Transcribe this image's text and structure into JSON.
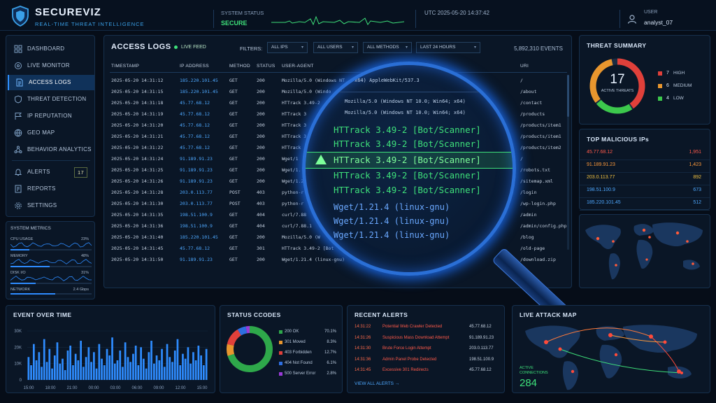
{
  "header": {
    "brand": "SECUREVIZ",
    "tagline": "REAL-TIME THREAT INTELLIGENCE",
    "system_status_label": "SYSTEM STATUS",
    "system_status_value": "SECURE",
    "utc": "UTC  2025-05-20 14:37:42",
    "user_label": "USER",
    "user_name": "analyst_07"
  },
  "sidebar": {
    "items": [
      {
        "label": "DASHBOARD",
        "icon": "dashboard-icon"
      },
      {
        "label": "LIVE MONITOR",
        "icon": "monitor-icon"
      },
      {
        "label": "ACCESS LOGS",
        "icon": "document-icon",
        "active": true
      },
      {
        "label": "THREAT DETECTION",
        "icon": "shield-icon"
      },
      {
        "label": "IP REPUTATION",
        "icon": "flag-icon"
      },
      {
        "label": "GEO MAP",
        "icon": "globe-icon"
      },
      {
        "label": "BEHAVIOR ANALYTICS",
        "icon": "network-icon"
      },
      {
        "label": "ALERTS",
        "icon": "bell-icon",
        "badge": "17"
      },
      {
        "label": "REPORTS",
        "icon": "report-icon"
      },
      {
        "label": "SETTINGS",
        "icon": "gear-icon"
      }
    ]
  },
  "metrics": {
    "title": "SYSTEM METRICS",
    "items": [
      {
        "label": "CPU USAGE",
        "value": "23%",
        "level": 0.23
      },
      {
        "label": "MEMORY",
        "value": "48%",
        "level": 0.48
      },
      {
        "label": "DISK I/O",
        "value": "31%",
        "level": 0.31
      },
      {
        "label": "NETWORK",
        "value": "2.4 Gbps",
        "level": 0.55
      }
    ]
  },
  "logs": {
    "title": "ACCESS LOGS",
    "live": "LIVE FEED",
    "filters_label": "FILTERS:",
    "filters": [
      "ALL IPS",
      "ALL USERS",
      "ALL METHODS",
      "LAST 24 HOURS"
    ],
    "events": "5,892,310 EVENTS",
    "columns": [
      "TIMESTAMP",
      "IP ADDRESS",
      "METHOD",
      "STATUS",
      "USER-AGENT",
      "URI"
    ],
    "rows": [
      [
        "2025-05-20  14:31:12",
        "185.220.101.45",
        "GET",
        "200",
        "Mozilla/5.0 (Windows NT",
        "/"
      ],
      [
        "2025-05-20  14:31:15",
        "185.220.101.45",
        "GET",
        "200",
        "Mozilla/5.0 (Windo",
        "/about"
      ],
      [
        "2025-05-20  14:31:18",
        "45.77.68.12",
        "GET",
        "200",
        "HTTrack 3.49-2",
        "/contact"
      ],
      [
        "2025-05-20  14:31:19",
        "45.77.68.12",
        "GET",
        "200",
        "HTTrack 3",
        "/products"
      ],
      [
        "2025-05-20  14:31:20",
        "45.77.68.12",
        "GET",
        "200",
        "HTTrack 3",
        "/products/item1"
      ],
      [
        "2025-05-20  14:31:21",
        "45.77.68.12",
        "GET",
        "200",
        "HTTrack 3",
        "/products/item1"
      ],
      [
        "2025-05-20  14:31:22",
        "45.77.68.12",
        "GET",
        "200",
        "HTTrack",
        "/products/item2"
      ],
      [
        "2025-05-20  14:31:24",
        "91.189.91.23",
        "GET",
        "200",
        "Wget/1",
        "/"
      ],
      [
        "2025-05-20  14:31:25",
        "91.189.91.23",
        "GET",
        "200",
        "Wget/1.",
        "/robots.txt"
      ],
      [
        "2025-05-20  14:31:26",
        "91.189.91.23",
        "GET",
        "200",
        "Wget/1.2",
        "/sitemap.xml"
      ],
      [
        "2025-05-20  14:31:28",
        "203.0.113.77",
        "POST",
        "403",
        "python-r",
        "/login"
      ],
      [
        "2025-05-20  14:31:30",
        "203.0.113.77",
        "POST",
        "403",
        "python-r",
        "/wp-login.php"
      ],
      [
        "2025-05-20  14:31:35",
        "198.51.100.9",
        "GET",
        "404",
        "curl/7.88",
        "/admin"
      ],
      [
        "2025-05-20  14:31:36",
        "198.51.100.9",
        "GET",
        "404",
        "curl/7.88.1",
        "/admin/config.php"
      ],
      [
        "2025-05-20  14:31:40",
        "185.220.101.45",
        "GET",
        "200",
        "Mozilla/5.0 (W",
        "/blog"
      ],
      [
        "2025-05-20  14:31:45",
        "45.77.68.12",
        "GET",
        "301",
        "HTTrack 3.49-2 [Bot",
        "/old-page"
      ],
      [
        "2025-05-20  14:31:50",
        "91.189.91.23",
        "GET",
        "200",
        "Wget/1.21.4 (linux-gnu)",
        "/download.zip"
      ]
    ]
  },
  "lens": {
    "lines": [
      "x64) AppleWebKit/537.3",
      "Mozilla/5.0 (Windows NT 10.0; Win64; x64)",
      "Mozilla/5.0 (Windows NT 10.0; Win64; x64)",
      "HTTrack 3.49-2 [Bot/Scanner]",
      "HTTrack 3.49-2 [Bot/Scanner]",
      "HTTrack 3.49-2 [Bot/Scanner]",
      "HTTrack 3.49-2 [Bot/Scanner]",
      "HTTrack 3.49-2 [Bot/Scanner]",
      "Wget/1.21.4 (linux-gnu)",
      "Wget/1.21.4 (linux-gnu)",
      "Wget/1.21.4 (linux-gnu)"
    ]
  },
  "threat": {
    "title": "THREAT SUMMARY",
    "count": "17",
    "count_label": "ACTIVE THREATS",
    "items": [
      {
        "n": "7",
        "label": "HIGH",
        "color": "#e0403a"
      },
      {
        "n": "6",
        "label": "MEDIUM",
        "color": "#e8962e"
      },
      {
        "n": "4",
        "label": "LOW",
        "color": "#3cc84c"
      }
    ]
  },
  "topips": {
    "title": "TOP MALICIOUS IPs",
    "items": [
      {
        "ip": "45.77.68.12",
        "n": "1,951",
        "color": "#ff5a4a"
      },
      {
        "ip": "91.189.91.23",
        "n": "1,423",
        "color": "#ff9a3a"
      },
      {
        "ip": "203.0.113.77",
        "n": "892",
        "color": "#f0c040"
      },
      {
        "ip": "198.51.100.9",
        "n": "673",
        "color": "#4ea8ff"
      },
      {
        "ip": "185.220.101.45",
        "n": "512",
        "color": "#4ea8ff"
      }
    ]
  },
  "eot": {
    "title": "EVENT OVER TIME",
    "yticks": [
      "30K",
      "20K",
      "10K",
      "0"
    ],
    "xticks": [
      "15:00",
      "18:00",
      "21:00",
      "00:00",
      "03:00",
      "06:00",
      "09:00",
      "12:00",
      "15:00"
    ]
  },
  "chart_data": {
    "type": "bar",
    "title": "EVENT OVER TIME",
    "ylim": [
      0,
      30000
    ],
    "values": [
      14000,
      9000,
      22000,
      12000,
      17000,
      8000,
      25000,
      11000,
      19000,
      7000,
      15000,
      23000,
      10000,
      13000,
      6000,
      18000,
      21000,
      9000,
      16000,
      12000,
      24000,
      8000,
      14000,
      20000,
      11000,
      17000,
      7000,
      22000,
      13000,
      9000,
      19000,
      15000,
      26000,
      10000,
      12000,
      18000,
      8000,
      23000,
      14000,
      11000,
      16000,
      21000,
      9000,
      20000,
      13000,
      7000,
      17000,
      24000,
      10000,
      15000,
      12000,
      19000,
      8000,
      22000,
      14000,
      11000,
      18000,
      25000,
      9000,
      16000,
      13000,
      20000,
      10000,
      17000,
      12000,
      21000,
      15000,
      9000,
      19000
    ]
  },
  "status": {
    "title": "STATUS CCODES",
    "items": [
      {
        "label": "200 OK",
        "pct": "70.1%",
        "value": 70.1,
        "color": "#2ea84a"
      },
      {
        "label": "301 Moved",
        "pct": "8.3%",
        "value": 8.3,
        "color": "#e8962e"
      },
      {
        "label": "403 Forbidden",
        "pct": "12.7%",
        "value": 12.7,
        "color": "#e0403a"
      },
      {
        "label": "404 Not Found",
        "pct": "6.1%",
        "value": 6.1,
        "color": "#2e6ee0"
      },
      {
        "label": "500 Server Error",
        "pct": "2.8%",
        "value": 2.8,
        "color": "#9a3ad8"
      }
    ]
  },
  "alerts": {
    "title": "RECENT ALERTS",
    "items": [
      {
        "t": "14:31:22",
        "msg": "Potential Web Crawler Detected",
        "ip": "45.77.68.12"
      },
      {
        "t": "14:31:26",
        "msg": "Suspicious Mass Download Attempt",
        "ip": "91.189.91.23"
      },
      {
        "t": "14:31:30",
        "msg": "Brute Force Login Attempt",
        "ip": "203.0.113.77"
      },
      {
        "t": "14:31:36",
        "msg": "Admin Panel Probe Detected",
        "ip": "198.51.100.9"
      },
      {
        "t": "14:31:45",
        "msg": "Excessive 301 Redirects",
        "ip": "45.77.68.12"
      }
    ],
    "view_all": "VIEW ALL ALERTS  →"
  },
  "live": {
    "title": "LIVE ATTACK MAP",
    "conn_label": "ACTIVE\nCONNECTIONS",
    "conn_value": "284"
  },
  "colors": {
    "accent": "#2e8cff",
    "secure": "#3ee07a",
    "danger": "#e0403a",
    "warning": "#e8962e",
    "ok": "#3cc84c"
  }
}
